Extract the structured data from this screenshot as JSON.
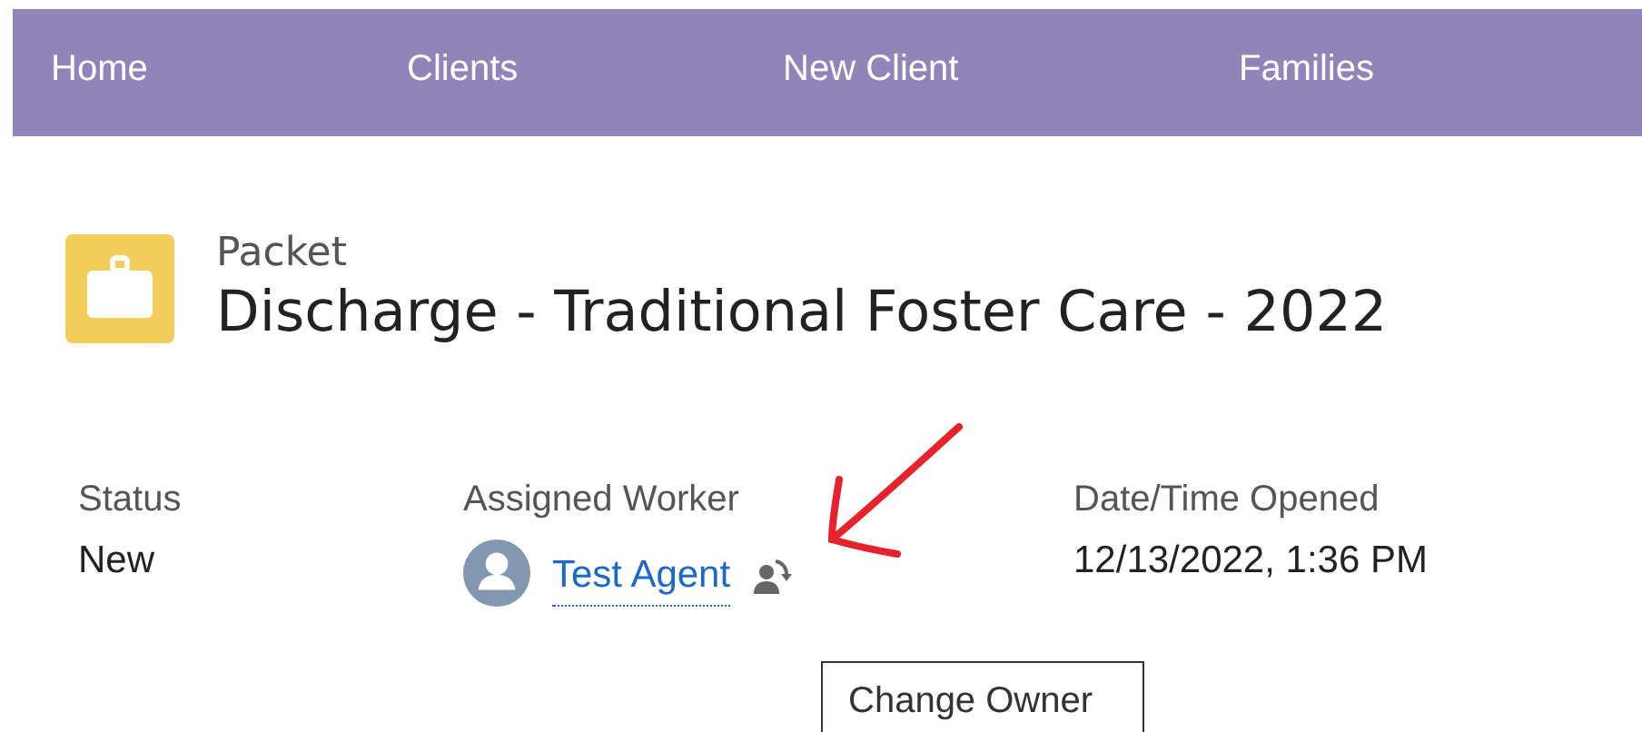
{
  "nav": {
    "items": [
      {
        "label": "Home"
      },
      {
        "label": "Clients"
      },
      {
        "label": "New Client"
      },
      {
        "label": "Families"
      }
    ]
  },
  "record": {
    "object_type": "Packet",
    "title": "Discharge - Traditional Foster Care - 2022"
  },
  "fields": [
    {
      "kind": "text",
      "label": "Status",
      "value": "New"
    },
    {
      "kind": "user",
      "label": "Assigned Worker",
      "value": "Test Agent"
    },
    {
      "kind": "text",
      "label": "Date/Time Opened",
      "value": "12/13/2022, 1:36 PM"
    }
  ],
  "tooltip": {
    "text": "Change Owner"
  }
}
